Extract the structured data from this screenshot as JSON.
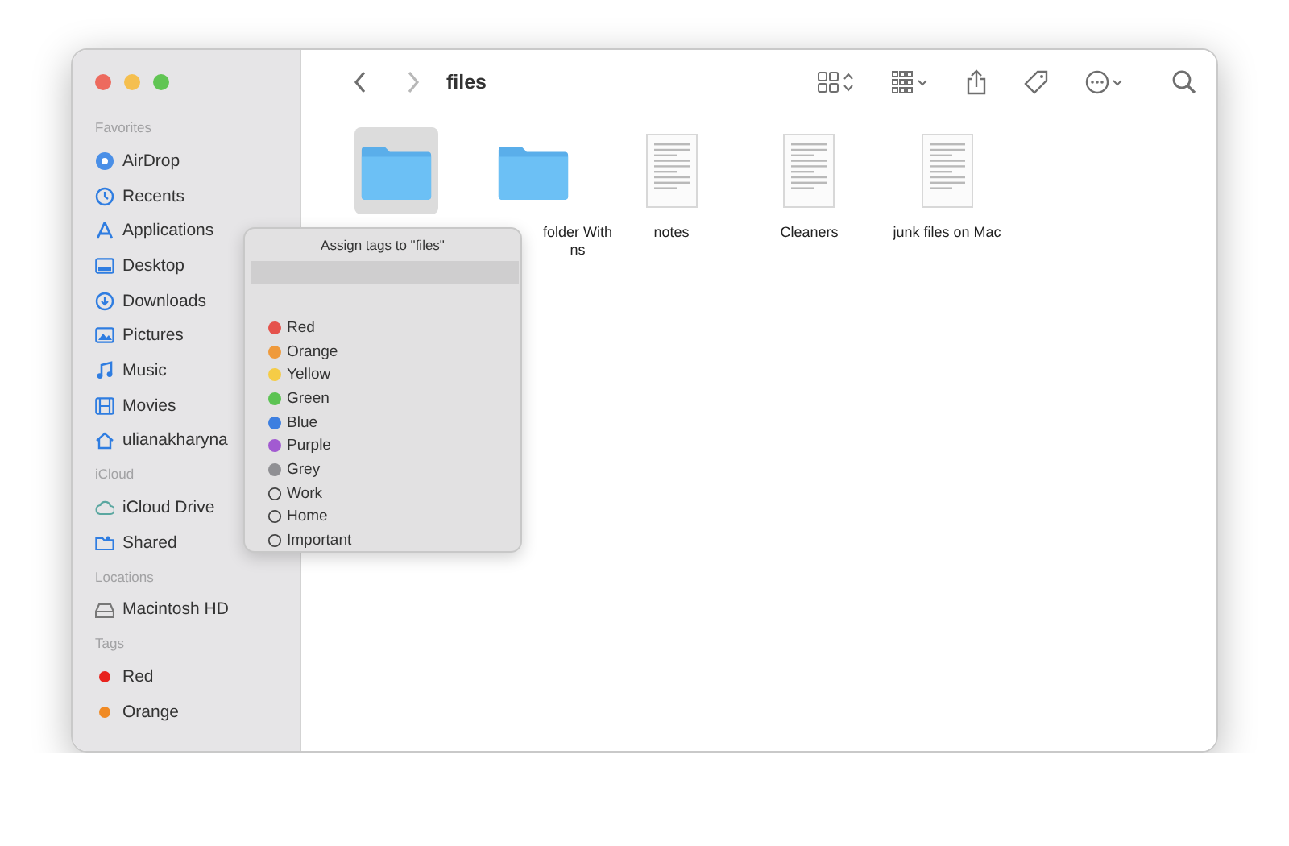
{
  "window": {
    "title": "files"
  },
  "sidebar": {
    "sections": [
      {
        "heading": "Favorites",
        "items": [
          {
            "label": "AirDrop",
            "kind": "airdrop"
          },
          {
            "label": "Recents",
            "kind": "clock"
          },
          {
            "label": "Applications",
            "kind": "apps"
          },
          {
            "label": "Desktop",
            "kind": "desktop"
          },
          {
            "label": "Downloads",
            "kind": "download"
          },
          {
            "label": "Pictures",
            "kind": "photo"
          },
          {
            "label": "Music",
            "kind": "note"
          },
          {
            "label": "Movies",
            "kind": "film"
          },
          {
            "label": "ulianakharyna",
            "kind": "home"
          }
        ]
      },
      {
        "heading": "iCloud",
        "items": [
          {
            "label": "iCloud Drive",
            "kind": "cloud"
          },
          {
            "label": "Shared",
            "kind": "shared"
          }
        ]
      },
      {
        "heading": "Locations",
        "items": [
          {
            "label": "Macintosh HD",
            "kind": "disk"
          }
        ]
      },
      {
        "heading": "Tags",
        "items": [
          {
            "label": "Red",
            "kind": "tag",
            "color": "#e8231e"
          },
          {
            "label": "Orange",
            "kind": "tag",
            "color": "#f08a24"
          }
        ]
      }
    ]
  },
  "files": [
    {
      "kind": "folder",
      "selected": true
    },
    {
      "kind": "folder",
      "selected": false,
      "name": [
        "folder With",
        "ns"
      ]
    },
    {
      "kind": "document",
      "selected": false,
      "name": [
        "notes"
      ]
    },
    {
      "kind": "document",
      "selected": false,
      "name": [
        "Cleaners"
      ]
    },
    {
      "kind": "document",
      "selected": false,
      "name": [
        "junk files on Mac"
      ]
    }
  ],
  "popover": {
    "title": "Assign tags to \"files\"",
    "tags": [
      {
        "label": "Red",
        "color": "#e5524c"
      },
      {
        "label": "Orange",
        "color": "#ef9a3c"
      },
      {
        "label": "Yellow",
        "color": "#f5cc46"
      },
      {
        "label": "Green",
        "color": "#5cc353"
      },
      {
        "label": "Blue",
        "color": "#3d7fe0"
      },
      {
        "label": "Purple",
        "color": "#a25ad1"
      },
      {
        "label": "Grey",
        "color": "#8f8f93"
      },
      {
        "label": "Work"
      },
      {
        "label": "Home"
      },
      {
        "label": "Important"
      }
    ]
  }
}
